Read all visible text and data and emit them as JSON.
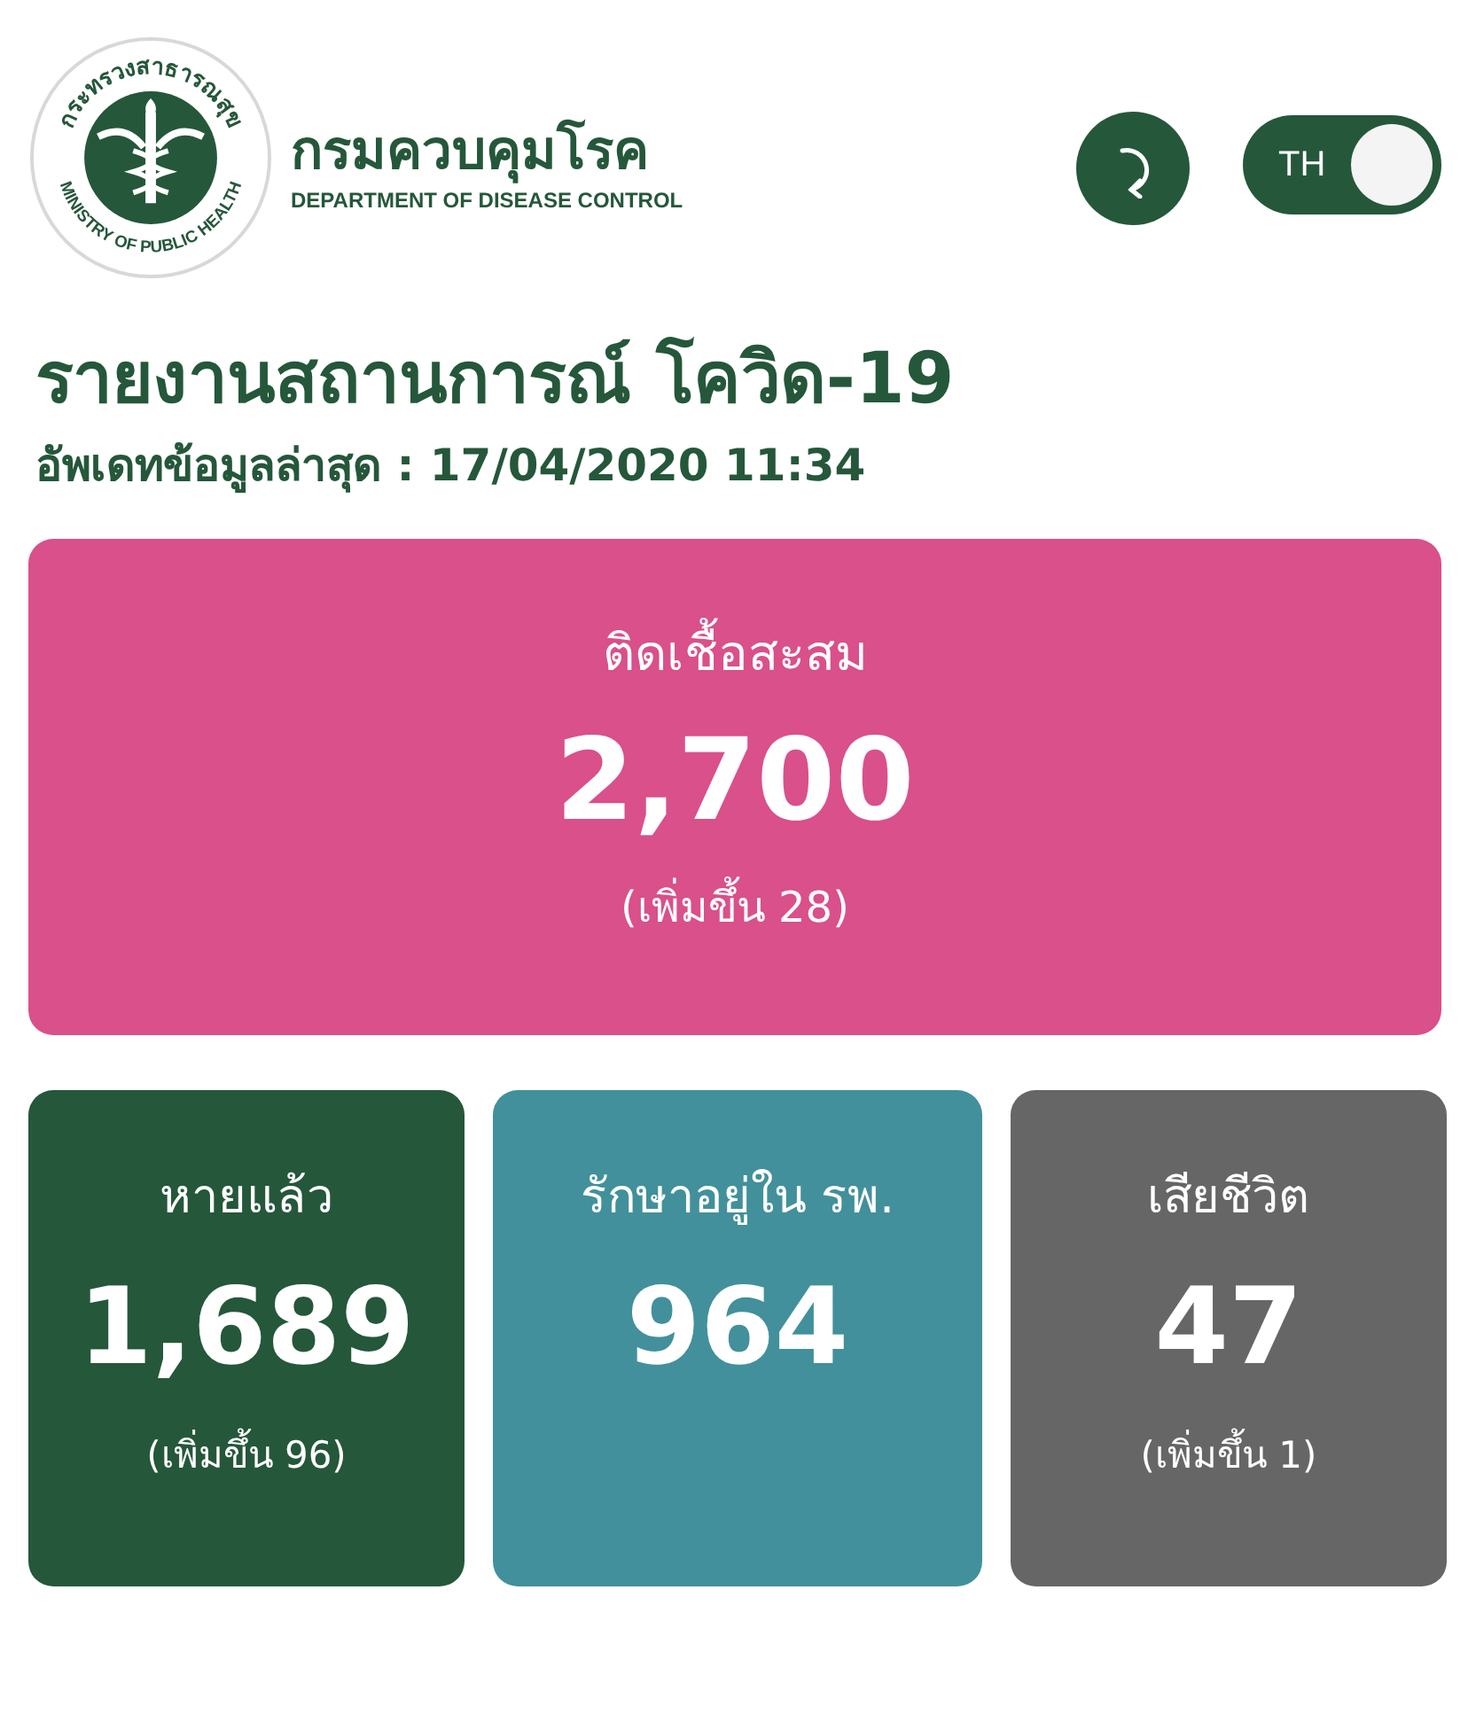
{
  "header": {
    "seal_top": "กระทรวงสาธารณสุข",
    "seal_bottom": "MINISTRY OF PUBLIC HEALTH",
    "org_name": "กรมควบคุมโรค",
    "org_name_en": "DEPARTMENT OF DISEASE CONTROL",
    "language_toggle": {
      "label": "TH",
      "on": true
    }
  },
  "title": "รายงานสถานการณ์ โควิด-19",
  "updated": "อัพเดทข้อมูลล่าสุด : 17/04/2020 11:34",
  "total": {
    "label": "ติดเชื้อสะสม",
    "value": "2,700",
    "change": "(เพิ่มขึ้น 28)",
    "color": "#d9508a"
  },
  "stats": [
    {
      "label": "หายแล้ว",
      "value": "1,689",
      "change": "(เพิ่มขึ้น 96)",
      "color": "#25573a"
    },
    {
      "label": "รักษาอยู่ใน รพ.",
      "value": "964",
      "color": "#42909b"
    },
    {
      "label": "เสียชีวิต",
      "value": "47",
      "change": "(เพิ่มขึ้น 1)",
      "color": "#666666"
    }
  ]
}
